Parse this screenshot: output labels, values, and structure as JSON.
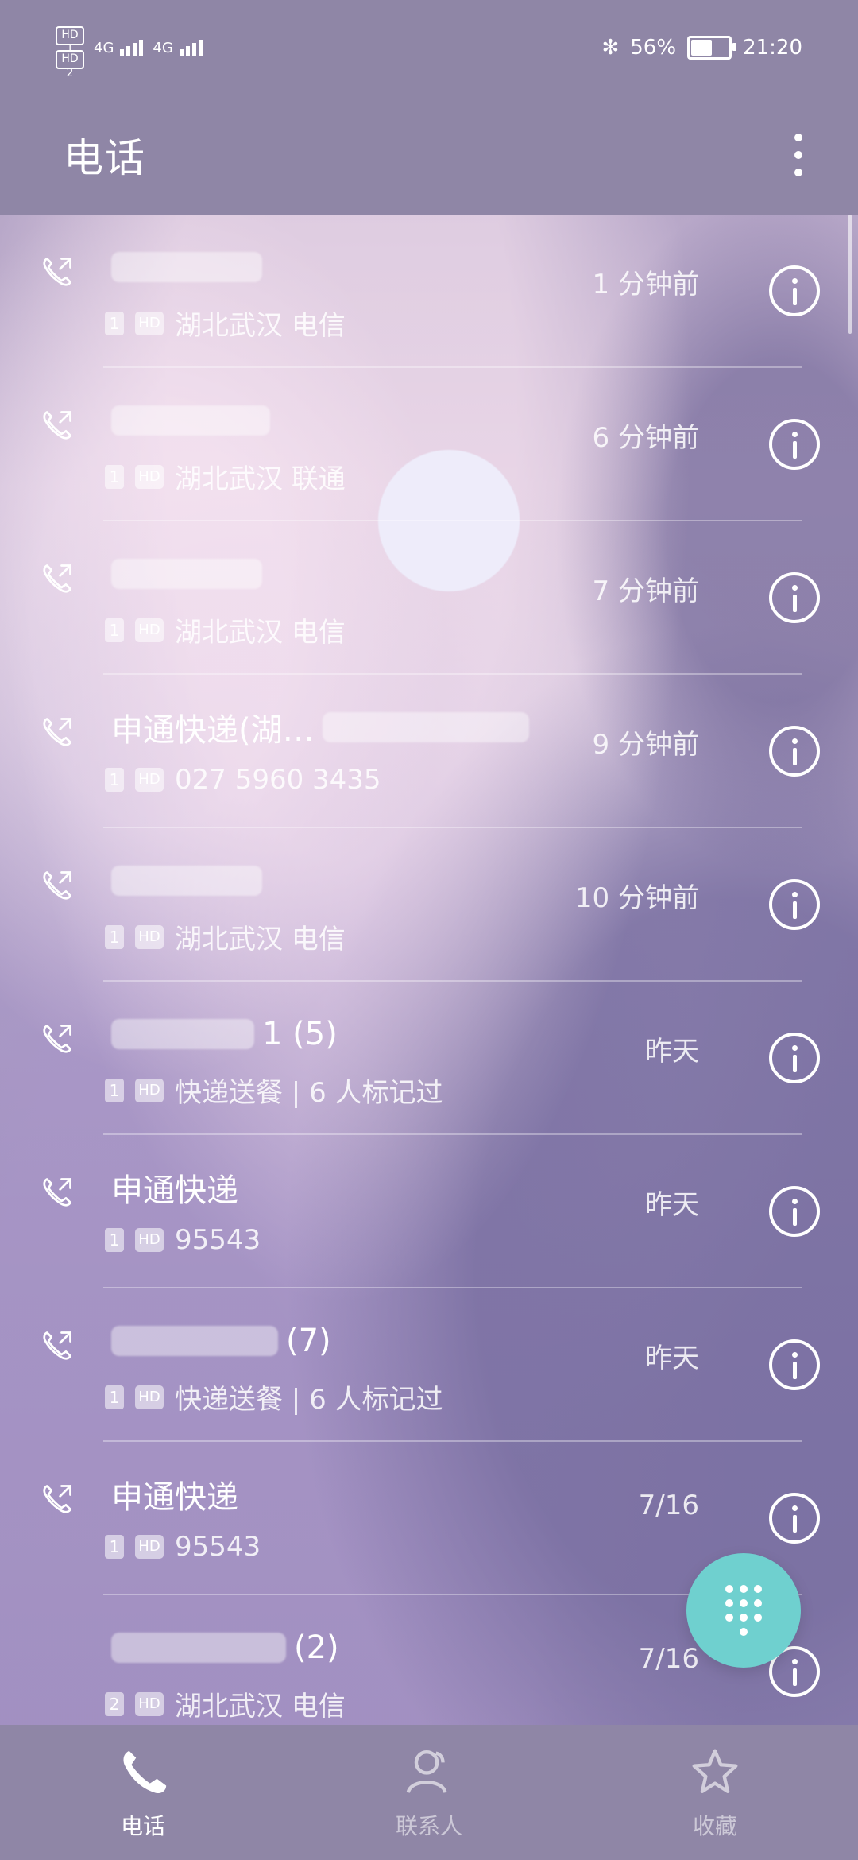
{
  "status_bar": {
    "sim1": "HD 1",
    "sim2": "HD 2",
    "net1": "4G",
    "net2": "4G",
    "battery": "56%",
    "time": "21:20"
  },
  "app_bar": {
    "title": "电话"
  },
  "calls": [
    {
      "name": "",
      "subtitle": "湖北武汉 电信",
      "sim": "1",
      "hd": "HD",
      "time": "1 分钟前"
    },
    {
      "name": "",
      "subtitle": "湖北武汉 联通",
      "sim": "1",
      "hd": "HD",
      "time": "6 分钟前"
    },
    {
      "name": "",
      "subtitle": "湖北武汉 电信",
      "sim": "1",
      "hd": "HD",
      "time": "7 分钟前"
    },
    {
      "name": "申通快递(湖…",
      "subtitle": "027 5960 3435",
      "sim": "1",
      "hd": "HD",
      "time": "9 分钟前"
    },
    {
      "name": "",
      "subtitle": "湖北武汉 电信",
      "sim": "1",
      "hd": "HD",
      "time": "10 分钟前"
    },
    {
      "name": "1 (5)",
      "subtitle": "快递送餐 | 6 人标记过",
      "sim": "1",
      "hd": "HD",
      "time": "昨天"
    },
    {
      "name": "申通快递",
      "subtitle": "95543",
      "sim": "1",
      "hd": "HD",
      "time": "昨天"
    },
    {
      "name": "(7)",
      "subtitle": "快递送餐 | 6 人标记过",
      "sim": "1",
      "hd": "HD",
      "time": "昨天"
    },
    {
      "name": "申通快递",
      "subtitle": "95543",
      "sim": "1",
      "hd": "HD",
      "time": "7/16"
    },
    {
      "name": "(2)",
      "subtitle": "湖北武汉 电信",
      "sim": "2",
      "hd": "HD",
      "time": "7/16"
    }
  ],
  "bottom_nav": {
    "phone": "电话",
    "contacts": "联系人",
    "favorites": "收藏"
  },
  "colors": {
    "fab": "#6fd0cf",
    "bar": "#8f86a6"
  }
}
